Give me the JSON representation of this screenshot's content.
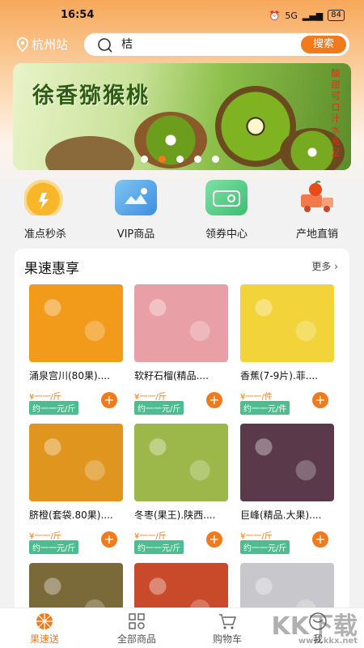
{
  "status": {
    "time": "16:54",
    "signal": "5G",
    "battery": "84"
  },
  "location": {
    "label": "杭州站"
  },
  "search": {
    "value": "桔",
    "button": "搜索"
  },
  "banner": {
    "title": "徐香猕猴桃",
    "side_text": "酸甜可口 汁水充足"
  },
  "categories": [
    {
      "label": "准点秒杀",
      "icon": "flash-sale-icon"
    },
    {
      "label": "VIP商品",
      "icon": "vip-icon"
    },
    {
      "label": "领券中心",
      "icon": "coupon-icon"
    },
    {
      "label": "产地直销",
      "icon": "delivery-truck-icon"
    }
  ],
  "section": {
    "title": "果速惠享",
    "more": "更多"
  },
  "products": [
    {
      "name": "涌泉宫川(80果)....",
      "price": "¥一一/斤",
      "tag": "约一一元/斤",
      "color": "#f29a1a"
    },
    {
      "name": "软籽石榴(精品....",
      "price": "¥一一/斤",
      "tag": "约一一元/斤",
      "color": "#e8a0a6"
    },
    {
      "name": "香蕉(7-9片).菲....",
      "price": "¥一一/件",
      "tag": "约一一元/件",
      "color": "#f2d43a"
    },
    {
      "name": "脐橙(套袋.80果)....",
      "price": "¥一一/斤",
      "tag": "约一一元/斤",
      "color": "#e0951e"
    },
    {
      "name": "冬枣(果王).陕西....",
      "price": "¥一一/斤",
      "tag": "约一一元/斤",
      "color": "#9cb84a"
    },
    {
      "name": "巨峰(精品.大果)....",
      "price": "¥一一/斤",
      "tag": "约一一元/斤",
      "color": "#5a3a4a"
    },
    {
      "name": "",
      "price": "",
      "tag": "",
      "color": "#7a6a3a"
    },
    {
      "name": "",
      "price": "",
      "tag": "",
      "color": "#c84a2a"
    },
    {
      "name": "",
      "price": "",
      "tag": "",
      "color": "#c8c8cc"
    }
  ],
  "nav": [
    {
      "label": "果速送",
      "icon": "home-fruit-icon"
    },
    {
      "label": "全部商品",
      "icon": "grid-icon"
    },
    {
      "label": "购物车",
      "icon": "cart-icon"
    },
    {
      "label": "我",
      "icon": "user-icon"
    }
  ],
  "watermark": {
    "text": "KK下载",
    "url": "www.kkx.net"
  },
  "colors": {
    "accent": "#f07a1c",
    "tag": "#4fbc8f"
  }
}
